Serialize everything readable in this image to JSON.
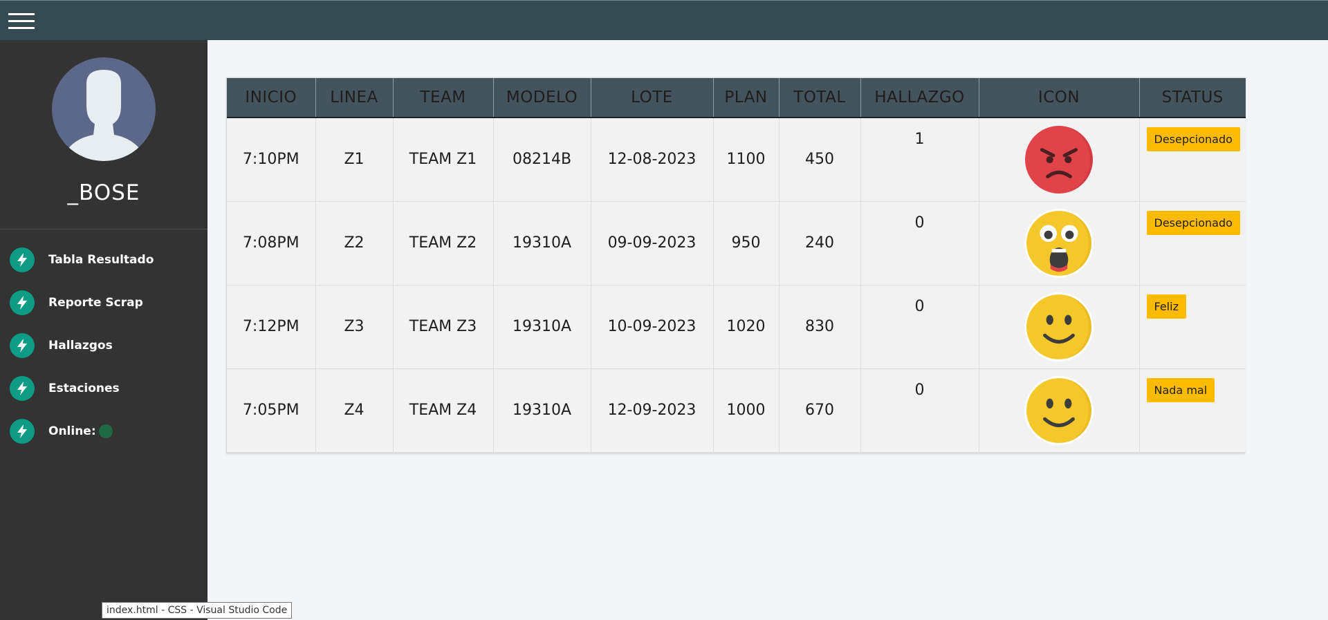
{
  "user": {
    "name": "_BOSE"
  },
  "sidebar": {
    "items": [
      {
        "label": "Tabla Resultado"
      },
      {
        "label": "Reporte Scrap"
      },
      {
        "label": "Hallazgos"
      },
      {
        "label": "Estaciones"
      },
      {
        "label": "Online:"
      }
    ],
    "online_status_color": "#1e6a44"
  },
  "table": {
    "headers": [
      "INICIO",
      "LINEA",
      "TEAM",
      "MODELO",
      "LOTE",
      "PLAN",
      "TOTAL",
      "HALLAZGO",
      "ICON",
      "STATUS"
    ],
    "rows": [
      {
        "inicio": "7:10PM",
        "linea": "Z1",
        "team": "TEAM Z1",
        "modelo": "08214B",
        "lote": "12-08-2023",
        "plan": "1100",
        "total": "450",
        "hallazgo": "1",
        "icon": "angry-face-icon",
        "status": "Desepcionado"
      },
      {
        "inicio": "7:08PM",
        "linea": "Z2",
        "team": "TEAM Z2",
        "modelo": "19310A",
        "lote": "09-09-2023",
        "plan": "950",
        "total": "240",
        "hallazgo": "0",
        "icon": "shocked-face-icon",
        "status": "Desepcionado"
      },
      {
        "inicio": "7:12PM",
        "linea": "Z3",
        "team": "TEAM Z3",
        "modelo": "19310A",
        "lote": "10-09-2023",
        "plan": "1020",
        "total": "830",
        "hallazgo": "0",
        "icon": "smiling-face-icon",
        "status": "Feliz"
      },
      {
        "inicio": "7:05PM",
        "linea": "Z4",
        "team": "TEAM Z4",
        "modelo": "19310A",
        "lote": "12-09-2023",
        "plan": "1000",
        "total": "670",
        "hallazgo": "0",
        "icon": "smiling-face-icon",
        "status": "Nada mal"
      }
    ]
  },
  "tooltip": {
    "text": "index.html - CSS - Visual Studio Code"
  },
  "colors": {
    "topbar": "#364a54",
    "sidebar": "#333333",
    "accent": "#0e9c84",
    "badge": "#ffbb00",
    "header": "#44545f"
  }
}
